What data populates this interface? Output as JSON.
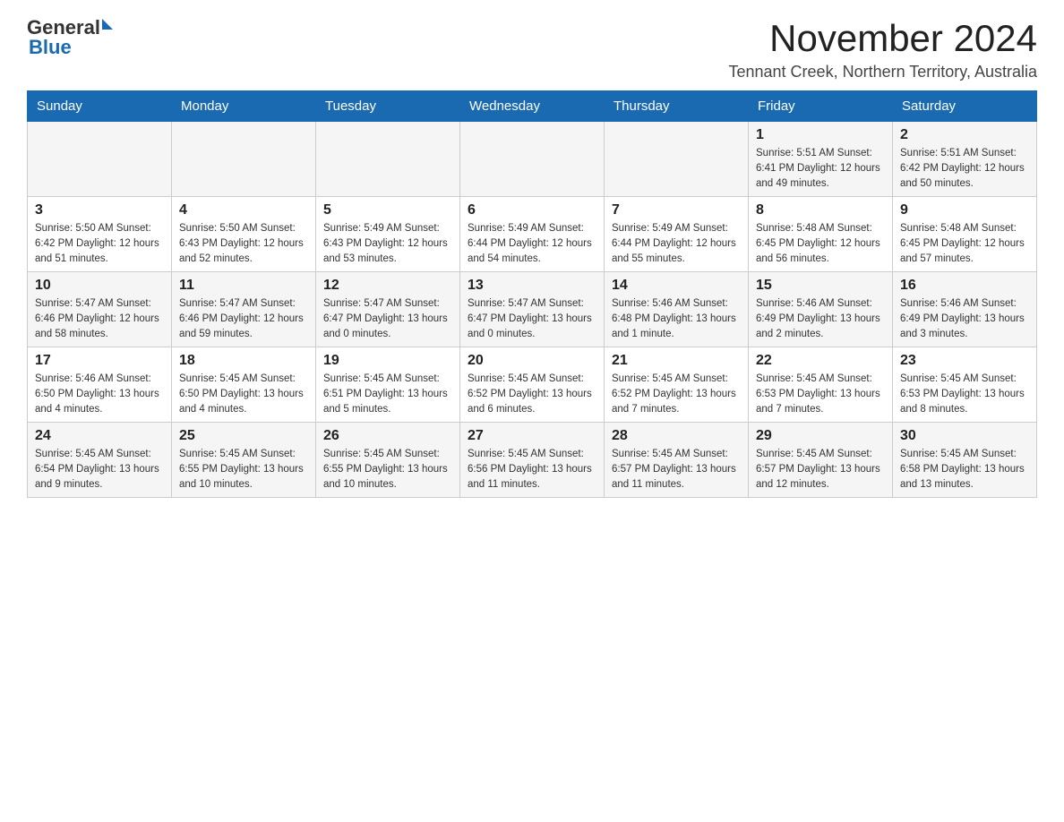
{
  "header": {
    "logo_general": "General",
    "logo_blue": "Blue",
    "month_title": "November 2024",
    "location": "Tennant Creek, Northern Territory, Australia"
  },
  "days_of_week": [
    "Sunday",
    "Monday",
    "Tuesday",
    "Wednesday",
    "Thursday",
    "Friday",
    "Saturday"
  ],
  "weeks": [
    [
      {
        "day": "",
        "info": ""
      },
      {
        "day": "",
        "info": ""
      },
      {
        "day": "",
        "info": ""
      },
      {
        "day": "",
        "info": ""
      },
      {
        "day": "",
        "info": ""
      },
      {
        "day": "1",
        "info": "Sunrise: 5:51 AM\nSunset: 6:41 PM\nDaylight: 12 hours and 49 minutes."
      },
      {
        "day": "2",
        "info": "Sunrise: 5:51 AM\nSunset: 6:42 PM\nDaylight: 12 hours and 50 minutes."
      }
    ],
    [
      {
        "day": "3",
        "info": "Sunrise: 5:50 AM\nSunset: 6:42 PM\nDaylight: 12 hours and 51 minutes."
      },
      {
        "day": "4",
        "info": "Sunrise: 5:50 AM\nSunset: 6:43 PM\nDaylight: 12 hours and 52 minutes."
      },
      {
        "day": "5",
        "info": "Sunrise: 5:49 AM\nSunset: 6:43 PM\nDaylight: 12 hours and 53 minutes."
      },
      {
        "day": "6",
        "info": "Sunrise: 5:49 AM\nSunset: 6:44 PM\nDaylight: 12 hours and 54 minutes."
      },
      {
        "day": "7",
        "info": "Sunrise: 5:49 AM\nSunset: 6:44 PM\nDaylight: 12 hours and 55 minutes."
      },
      {
        "day": "8",
        "info": "Sunrise: 5:48 AM\nSunset: 6:45 PM\nDaylight: 12 hours and 56 minutes."
      },
      {
        "day": "9",
        "info": "Sunrise: 5:48 AM\nSunset: 6:45 PM\nDaylight: 12 hours and 57 minutes."
      }
    ],
    [
      {
        "day": "10",
        "info": "Sunrise: 5:47 AM\nSunset: 6:46 PM\nDaylight: 12 hours and 58 minutes."
      },
      {
        "day": "11",
        "info": "Sunrise: 5:47 AM\nSunset: 6:46 PM\nDaylight: 12 hours and 59 minutes."
      },
      {
        "day": "12",
        "info": "Sunrise: 5:47 AM\nSunset: 6:47 PM\nDaylight: 13 hours and 0 minutes."
      },
      {
        "day": "13",
        "info": "Sunrise: 5:47 AM\nSunset: 6:47 PM\nDaylight: 13 hours and 0 minutes."
      },
      {
        "day": "14",
        "info": "Sunrise: 5:46 AM\nSunset: 6:48 PM\nDaylight: 13 hours and 1 minute."
      },
      {
        "day": "15",
        "info": "Sunrise: 5:46 AM\nSunset: 6:49 PM\nDaylight: 13 hours and 2 minutes."
      },
      {
        "day": "16",
        "info": "Sunrise: 5:46 AM\nSunset: 6:49 PM\nDaylight: 13 hours and 3 minutes."
      }
    ],
    [
      {
        "day": "17",
        "info": "Sunrise: 5:46 AM\nSunset: 6:50 PM\nDaylight: 13 hours and 4 minutes."
      },
      {
        "day": "18",
        "info": "Sunrise: 5:45 AM\nSunset: 6:50 PM\nDaylight: 13 hours and 4 minutes."
      },
      {
        "day": "19",
        "info": "Sunrise: 5:45 AM\nSunset: 6:51 PM\nDaylight: 13 hours and 5 minutes."
      },
      {
        "day": "20",
        "info": "Sunrise: 5:45 AM\nSunset: 6:52 PM\nDaylight: 13 hours and 6 minutes."
      },
      {
        "day": "21",
        "info": "Sunrise: 5:45 AM\nSunset: 6:52 PM\nDaylight: 13 hours and 7 minutes."
      },
      {
        "day": "22",
        "info": "Sunrise: 5:45 AM\nSunset: 6:53 PM\nDaylight: 13 hours and 7 minutes."
      },
      {
        "day": "23",
        "info": "Sunrise: 5:45 AM\nSunset: 6:53 PM\nDaylight: 13 hours and 8 minutes."
      }
    ],
    [
      {
        "day": "24",
        "info": "Sunrise: 5:45 AM\nSunset: 6:54 PM\nDaylight: 13 hours and 9 minutes."
      },
      {
        "day": "25",
        "info": "Sunrise: 5:45 AM\nSunset: 6:55 PM\nDaylight: 13 hours and 10 minutes."
      },
      {
        "day": "26",
        "info": "Sunrise: 5:45 AM\nSunset: 6:55 PM\nDaylight: 13 hours and 10 minutes."
      },
      {
        "day": "27",
        "info": "Sunrise: 5:45 AM\nSunset: 6:56 PM\nDaylight: 13 hours and 11 minutes."
      },
      {
        "day": "28",
        "info": "Sunrise: 5:45 AM\nSunset: 6:57 PM\nDaylight: 13 hours and 11 minutes."
      },
      {
        "day": "29",
        "info": "Sunrise: 5:45 AM\nSunset: 6:57 PM\nDaylight: 13 hours and 12 minutes."
      },
      {
        "day": "30",
        "info": "Sunrise: 5:45 AM\nSunset: 6:58 PM\nDaylight: 13 hours and 13 minutes."
      }
    ]
  ]
}
